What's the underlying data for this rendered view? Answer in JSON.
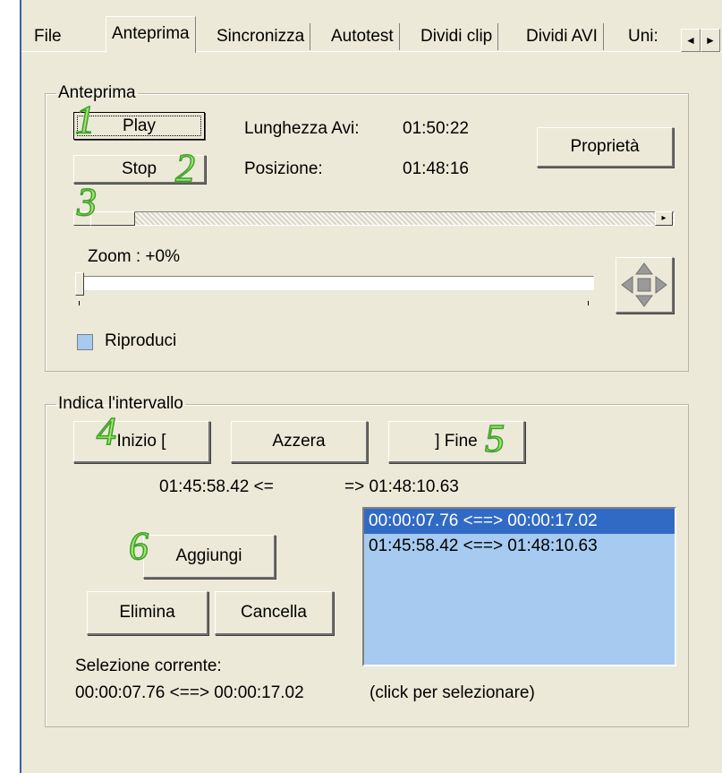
{
  "tabs": [
    "File",
    "Anteprima",
    "Sincronizza",
    "Autotest",
    "Dividi clip",
    "Dividi AVI",
    "Uni:"
  ],
  "tab_scroll": {
    "left": "◄",
    "right": "►"
  },
  "anteprima": {
    "legend": "Anteprima",
    "play_label": "Play",
    "stop_label": "Stop",
    "length_label": "Lunghezza Avi:",
    "length_value": "01:50:22",
    "position_label": "Posizione:",
    "position_value": "01:48:16",
    "properties_label": "Proprietà",
    "zoom_label": "Zoom :  +0%",
    "play_checkbox_label": "Riproduci",
    "play_checkbox_checked": false,
    "seek_scroll_fraction": 0.0,
    "zoom_fraction": 0.0
  },
  "intervallo": {
    "legend": "Indica l'intervallo",
    "start_label": "Inizio [",
    "reset_label": "Azzera",
    "end_label": "] Fine",
    "start_value": "01:45:58.42 <=",
    "end_value": "=> 01:48:10.63",
    "add_label": "Aggiungi",
    "delete_label": "Elimina",
    "clear_label": "Cancella",
    "current_selection_label": "Selezione corrente:",
    "current_selection_value": "00:00:07.76 <==> 00:00:17.02",
    "click_hint": "(click per selezionare)",
    "intervals": [
      "00:00:07.76 <==> 00:00:17.02",
      "01:45:58.42 <==> 01:48:10.63"
    ],
    "selected_index": 0
  },
  "annotations": [
    "1",
    "2",
    "3",
    "4",
    "5",
    "6"
  ],
  "colors": {
    "panel": "#ece9d8",
    "selection": "#316ac5",
    "list_bg": "#a6caf0",
    "annotation": "#9be86a"
  },
  "icons": {
    "pan": "move-arrows-icon"
  }
}
